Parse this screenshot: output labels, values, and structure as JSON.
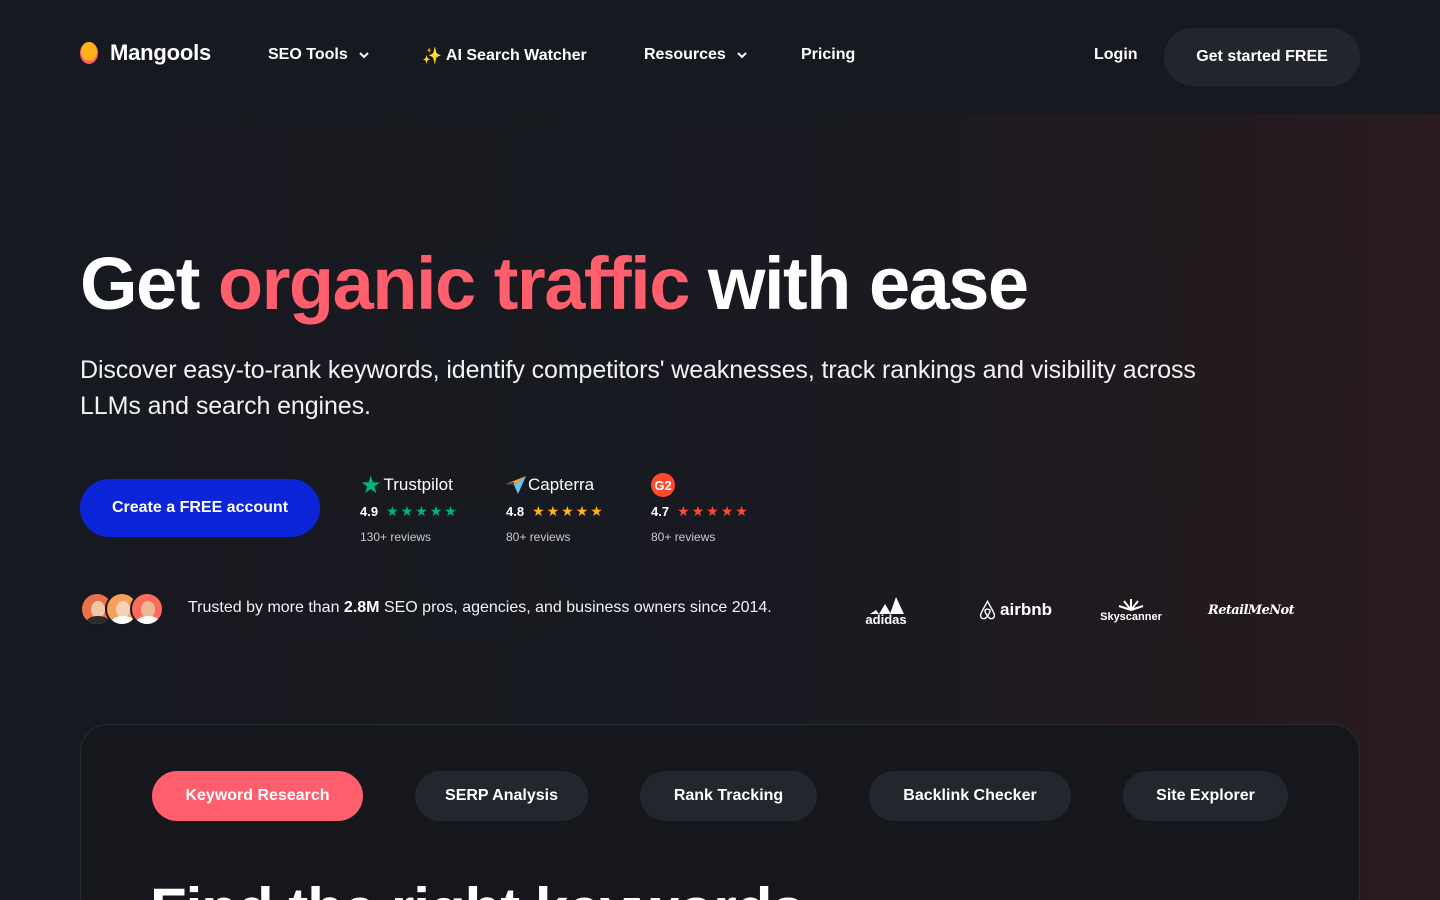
{
  "nav": {
    "logo": "Mangools",
    "items": [
      {
        "label": "SEO Tools",
        "dropdown": true
      },
      {
        "label": "AI Search Watcher",
        "icon": "sparkle-icon"
      },
      {
        "label": "Resources",
        "dropdown": true
      },
      {
        "label": "Pricing"
      }
    ],
    "login": "Login",
    "cta": "Get started FREE"
  },
  "hero": {
    "title_start": "Get ",
    "title_accent": "organic traffic",
    "title_end": " with ease",
    "subtitle": "Discover easy-to-rank keywords, identify competitors' weaknesses, track rankings and visibility across LLMs and search engines.",
    "cta": "Create a FREE account"
  },
  "ratings": [
    {
      "brand": "Trustpilot",
      "score": "4.9",
      "reviews": "130+ reviews",
      "star_color": "#00b67a"
    },
    {
      "brand": "Capterra",
      "score": "4.8",
      "reviews": "80+ reviews",
      "star_color": "#ffb21a"
    },
    {
      "brand": "G2",
      "score": "4.7",
      "reviews": "80+ reviews",
      "star_color": "#ff492c"
    }
  ],
  "trust": {
    "prefix": "Trusted by more than ",
    "highlight": "2.8M",
    "suffix": " SEO pros, agencies, and business owners since 2014.",
    "avatar_colors": [
      "#e8734a",
      "#f4a259",
      "#ff6b5b"
    ]
  },
  "clients": [
    "adidas",
    "airbnb",
    "Skyscanner",
    "RetailMeNot"
  ],
  "tabs": [
    {
      "label": "Keyword Research",
      "active": true
    },
    {
      "label": "SERP Analysis",
      "active": false
    },
    {
      "label": "Rank Tracking",
      "active": false
    },
    {
      "label": "Backlink Checker",
      "active": false
    },
    {
      "label": "Site Explorer",
      "active": false
    }
  ],
  "panel_heading_peek": "Find the right keywords",
  "colors": {
    "background": "#171920",
    "accent": "#ff5e6c",
    "primary_button": "#0c25d8",
    "secondary_button": "#23252c"
  }
}
